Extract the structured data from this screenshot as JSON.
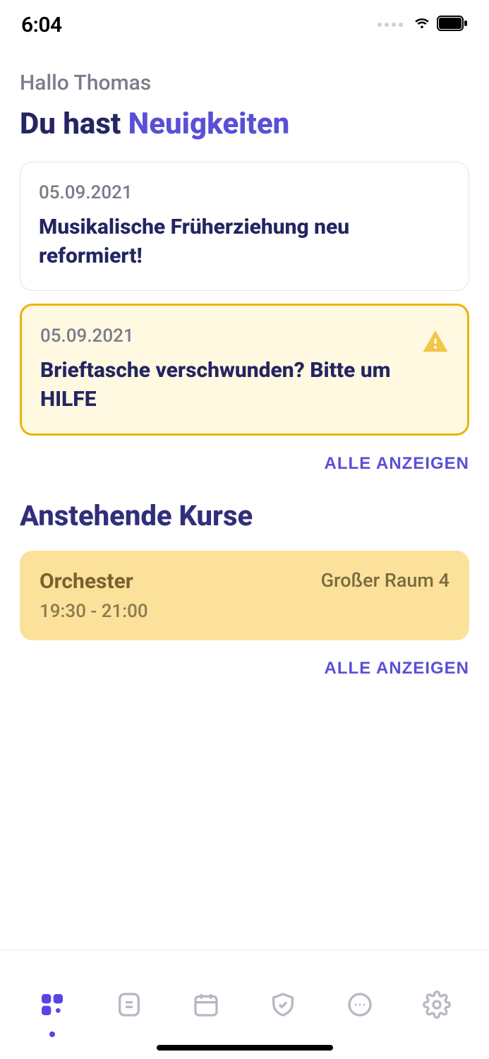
{
  "statusbar": {
    "time": "6:04"
  },
  "greeting": "Hallo Thomas",
  "headline": {
    "prefix": "Du hast ",
    "accent": "Neuigkeiten"
  },
  "news": [
    {
      "date": "05.09.2021",
      "title": "Musikalische Früherziehung neu reformiert!",
      "alert": false
    },
    {
      "date": "05.09.2021",
      "title": "Brieftasche verschwunden? Bitte um HILFE",
      "alert": true
    }
  ],
  "show_all_label": "ALLE ANZEIGEN",
  "upcoming_section_title": "Anstehende Kurse",
  "courses": [
    {
      "name": "Orchester",
      "time": "19:30 - 21:00",
      "room": "Großer Raum 4"
    }
  ],
  "nav": {
    "items": [
      "home",
      "notes",
      "calendar",
      "shield",
      "chat",
      "settings"
    ],
    "active": "home"
  },
  "colors": {
    "accent": "#5a4fd6",
    "dark": "#242561",
    "muted": "#7b7b8a",
    "alert_bg": "#fff9e2",
    "alert_border": "#eab308",
    "course_bg": "#fbe19a",
    "nav_inactive": "#b7b7c5"
  }
}
